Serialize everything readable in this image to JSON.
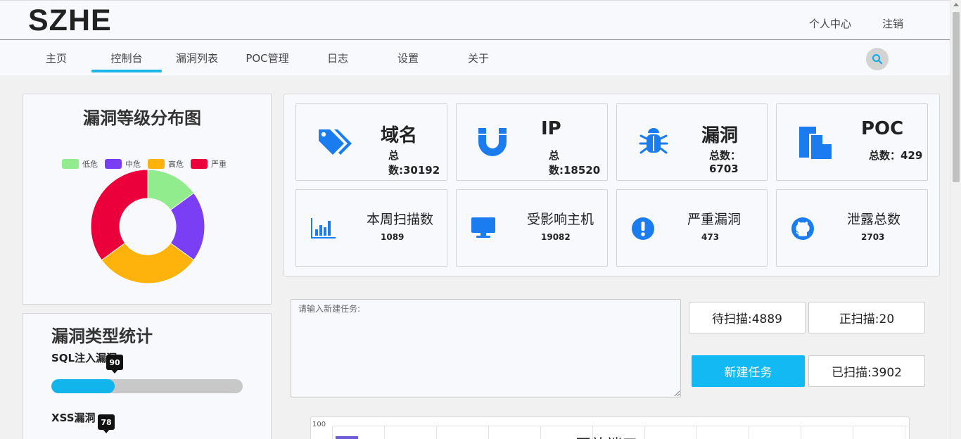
{
  "header": {
    "logo": "SZHE",
    "profile_label": "个人中心",
    "logout_label": "注销"
  },
  "nav": {
    "items": [
      "主页",
      "控制台",
      "漏洞列表",
      "POC管理",
      "日志",
      "设置",
      "关于"
    ],
    "active_index": 1
  },
  "severity_chart": {
    "title": "漏洞等级分布图",
    "chart_data": {
      "type": "pie",
      "donut": true,
      "categories": [
        "低危",
        "中危",
        "高危",
        "严重"
      ],
      "values": [
        15,
        20,
        30,
        35
      ],
      "colors": [
        "#90ec8d",
        "#7a3ff5",
        "#fdb20c",
        "#eb003b"
      ],
      "legend_position": "top"
    }
  },
  "stats": {
    "domain": {
      "title": "域名",
      "count": "总数:30192"
    },
    "ip": {
      "title": "IP",
      "count": "总数:18520"
    },
    "vuln": {
      "title": "漏洞",
      "count": "总数：6703"
    },
    "poc": {
      "title": "POC",
      "count": "总数：429"
    },
    "weekly_scans": {
      "title": "本周扫描数",
      "count": "1089"
    },
    "affected_hosts": {
      "title": "受影响主机",
      "count": "19082"
    },
    "critical_vulns": {
      "title": "严重漏洞",
      "count": "473"
    },
    "leaks": {
      "title": "泄露总数",
      "count": "2703"
    }
  },
  "vuln_types": {
    "title": "漏洞类型统计",
    "items": [
      {
        "label": "SQL注入漏洞",
        "value": 90,
        "value_text": "90",
        "percent": 33
      },
      {
        "label": "XSS漏洞",
        "value": 78,
        "value_text": "78"
      }
    ]
  },
  "task": {
    "placeholder": "请输入新建任务:",
    "pending": "待扫描:4889",
    "scanning": "正扫描:20",
    "new_task_label": "新建任务",
    "scanned": "已扫描:3902"
  },
  "port_chart": {
    "title": "开放端口",
    "chart_data": {
      "type": "bar",
      "title": "开放端口",
      "y_tick_top": "100",
      "series_color": "#6b5bd6"
    }
  }
}
